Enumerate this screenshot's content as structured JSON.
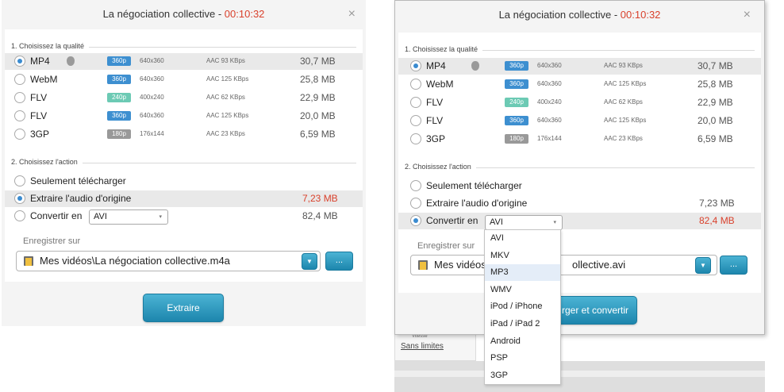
{
  "left": {
    "title": "La négociation collective",
    "title_sep": " - ",
    "timer": "00:10:32",
    "close": "×",
    "quality_title": "1. Choisissez la qualité",
    "action_title": "2. Choisissez l'action",
    "formats": [
      {
        "format": "MP4",
        "badge": "360p",
        "res": "640x360",
        "audio": "AAC 93 KBps",
        "size": "30,7 MB",
        "apple": true
      },
      {
        "format": "WebM",
        "badge": "360p",
        "res": "640x360",
        "audio": "AAC 125 KBps",
        "size": "25,8 MB"
      },
      {
        "format": "FLV",
        "badge": "240p",
        "res": "400x240",
        "audio": "AAC 62 KBps",
        "size": "22,9 MB"
      },
      {
        "format": "FLV",
        "badge": "360p",
        "res": "640x360",
        "audio": "AAC 125 KBps",
        "size": "20,0 MB"
      },
      {
        "format": "3GP",
        "badge": "180p",
        "res": "176x144",
        "audio": "AAC 23 KBps",
        "size": "6,59 MB"
      }
    ],
    "actions": [
      {
        "label": "Seulement télécharger",
        "size": ""
      },
      {
        "label": "Extraire l'audio d'origine",
        "size": "7,23 MB"
      },
      {
        "label": "Convertir en",
        "size": "82,4 MB"
      }
    ],
    "convert_value": "AVI",
    "save_label": "Enregistrer sur",
    "path": "Mes vidéos\\La négociation collective.m4a",
    "more_button": "...",
    "main_button": "Extraire"
  },
  "right": {
    "title": "La négociation collective",
    "title_sep": " - ",
    "timer": "00:10:32",
    "close": "×",
    "quality_title": "1. Choisissez la qualité",
    "action_title": "2. Choisissez l'action",
    "formats": [
      {
        "format": "MP4",
        "badge": "360p",
        "res": "640x360",
        "audio": "AAC 93 KBps",
        "size": "30,7 MB",
        "apple": true
      },
      {
        "format": "WebM",
        "badge": "360p",
        "res": "640x360",
        "audio": "AAC 125 KBps",
        "size": "25,8 MB"
      },
      {
        "format": "FLV",
        "badge": "240p",
        "res": "400x240",
        "audio": "AAC 62 KBps",
        "size": "22,9 MB"
      },
      {
        "format": "FLV",
        "badge": "360p",
        "res": "640x360",
        "audio": "AAC 125 KBps",
        "size": "20,0 MB"
      },
      {
        "format": "3GP",
        "badge": "180p",
        "res": "176x144",
        "audio": "AAC 23 KBps",
        "size": "6,59 MB"
      }
    ],
    "actions": [
      {
        "label": "Seulement télécharger",
        "size": ""
      },
      {
        "label": "Extraire l'audio d'origine",
        "size": "7,23 MB"
      },
      {
        "label": "Convertir en",
        "size": "82,4 MB"
      }
    ],
    "convert_value": "AVI",
    "save_label": "Enregistrer sur",
    "path_start": "Mes vidéos",
    "path_end": "ollective.avi",
    "more_button": "...",
    "main_button_visible": "rger et convertir",
    "dropdown_options": [
      "AVI",
      "MKV",
      "MP3",
      "WMV",
      "iPod / iPhone",
      "iPad / iPad 2",
      "Android",
      "PSP",
      "3GP"
    ],
    "dropdown_highlighted": "MP3"
  },
  "background": {
    "vitesse_label": "Vitesse",
    "sans_limites": "Sans limites"
  },
  "colors": {
    "accent_red": "#d9412c",
    "badge_blue": "#3d8fd0",
    "badge_green": "#6ccab4",
    "badge_gray": "#999999",
    "button_blue": "#2a9bc3"
  },
  "icons": {
    "apple": "apple-icon",
    "folder": "folder-icon",
    "dropdown_arrow": "chevron-down-icon"
  }
}
